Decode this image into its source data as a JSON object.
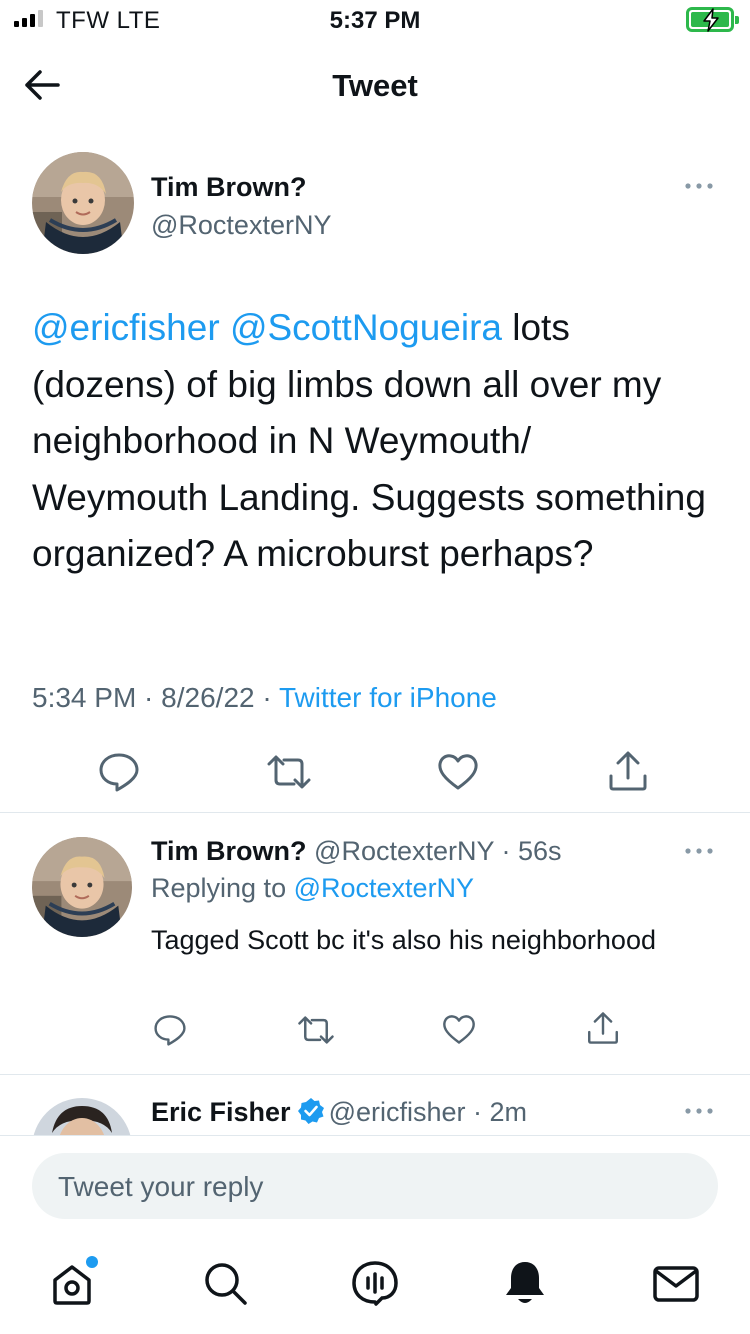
{
  "status_bar": {
    "carrier": "TFW  LTE",
    "time": "5:37 PM",
    "battery_color": "#2db84b"
  },
  "nav": {
    "title": "Tweet",
    "back_icon": "arrow-left-icon"
  },
  "main_tweet": {
    "author_name": "Tim Brown?",
    "author_handle": "@RoctexterNY",
    "text_parts": {
      "mention1": "@ericfisher",
      "mention2": "@ScottNogueira",
      "body": " lots (dozens) of big limbs down all over my neighborhood in N Weymouth/ Weymouth Landing. Suggests something organized? A microburst perhaps?"
    },
    "time": "5:34 PM",
    "date": "8/26/22",
    "source": "Twitter for iPhone",
    "separator": " · "
  },
  "replies": [
    {
      "author_name": "Tim Brown?",
      "author_handle": "@RoctexterNY",
      "age": "56s",
      "replying_label": "Replying to",
      "replying_to": "@RoctexterNY",
      "text": "Tagged Scott bc it's also his neighborhood"
    },
    {
      "author_name": "Eric Fisher",
      "author_handle": "@ericfisher",
      "age": "2m",
      "verified": true
    }
  ],
  "reply_box": {
    "placeholder": "Tweet your reply"
  },
  "tab_bar": {
    "items": [
      "home-icon",
      "search-icon",
      "spaces-icon",
      "notifications-icon",
      "messages-icon"
    ]
  },
  "colors": {
    "accent": "#1d9bf0",
    "text": "#0f1419",
    "secondary": "#536471"
  }
}
